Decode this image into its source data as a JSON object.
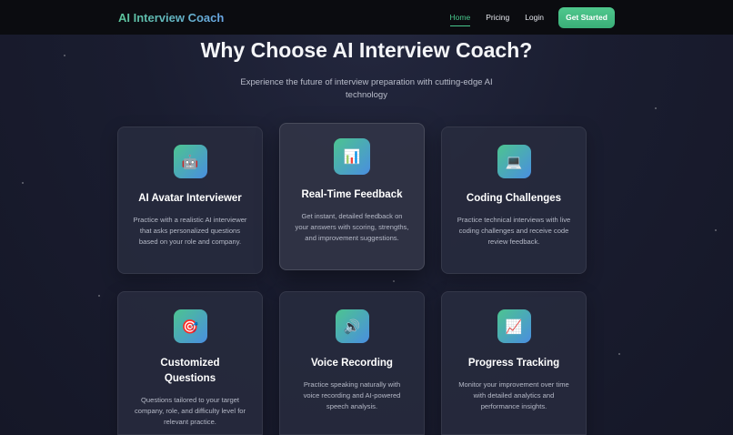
{
  "nav": {
    "brand": "AI Interview Coach",
    "links": [
      "Home",
      "Pricing",
      "Login"
    ],
    "cta": "Get Started"
  },
  "hero": {
    "title": "Why Choose AI Interview Coach?",
    "subtitle": "Experience the future of interview preparation with cutting-edge AI technology"
  },
  "features": [
    {
      "icon": "robot-icon",
      "glyph": "🤖",
      "title": "AI Avatar Interviewer",
      "desc": "Practice with a realistic AI interviewer that asks personalized questions based on your role and company."
    },
    {
      "icon": "bar-chart-icon",
      "glyph": "📊",
      "title": "Real-Time Feedback",
      "desc": "Get instant, detailed feedback on your answers with scoring, strengths, and improvement suggestions."
    },
    {
      "icon": "laptop-icon",
      "glyph": "💻",
      "title": "Coding Challenges",
      "desc": "Practice technical interviews with live coding challenges and receive code review feedback."
    },
    {
      "icon": "target-icon",
      "glyph": "🎯",
      "title": "Customized Questions",
      "desc": "Questions tailored to your target company, role, and difficulty level for relevant practice."
    },
    {
      "icon": "speaker-icon",
      "glyph": "🔊",
      "title": "Voice Recording",
      "desc": "Practice speaking naturally with voice recording and AI-powered speech analysis."
    },
    {
      "icon": "line-chart-icon",
      "glyph": "📈",
      "title": "Progress Tracking",
      "desc": "Monitor your improvement over time with detailed analytics and performance insights."
    }
  ],
  "colors": {
    "accent": "#48c98d",
    "nav_bg": "#0b0c10",
    "page_bg": "#1a1d30",
    "card_bg": "#282c3e"
  }
}
